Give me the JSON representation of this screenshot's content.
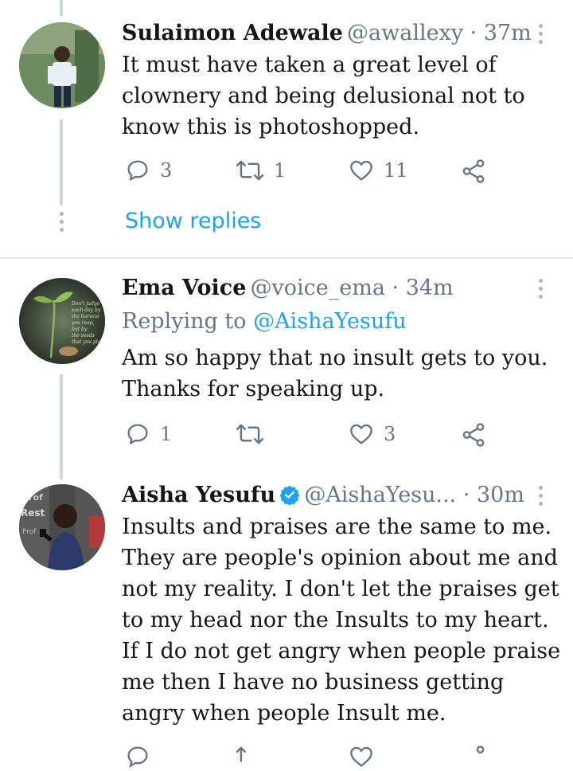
{
  "tweets": [
    {
      "name": "Sulaimon Adewale",
      "handle": "@awallexy",
      "time": "37m",
      "text": "It must have taken a great level of\nclownery and being delusional not to\nknow this is photoshopped.",
      "replies": "3",
      "retweets": "1",
      "likes": "11",
      "show_replies": "Show replies"
    },
    {
      "name": "Ema Voice",
      "handle": "@voice_ema",
      "time": "34m",
      "replying_prefix": "Replying to ",
      "replying_to": "@AishaYesufu",
      "text": "Am so happy that no insult gets to you.\nThanks for speaking up.",
      "replies": "1",
      "retweets": "",
      "likes": "3",
      "avatar_text": "Don't judge each day by the harvest you reap, but by the seeds that you plant."
    },
    {
      "name": "Aisha Yesufu",
      "handle": "@AishaYesu...",
      "time": "30m",
      "text": "Insults and praises are the same to me.\nThey are people's opinion about me and\nnot my reality. I don't let the praises get\nto my head nor the Insults to my heart.\n If I do not get angry when people praise\nme then I have no business getting\nangry when people Insult me.",
      "verified": true
    }
  ],
  "separator": " · ",
  "colors": {
    "link": "#1da1f2",
    "secondary": "#657786",
    "thread_line": "#cdd6dd",
    "verified": "#1da1f2"
  },
  "icons": [
    "reply-icon",
    "retweet-icon",
    "like-icon",
    "share-icon",
    "more-icon",
    "verified-badge-icon"
  ]
}
